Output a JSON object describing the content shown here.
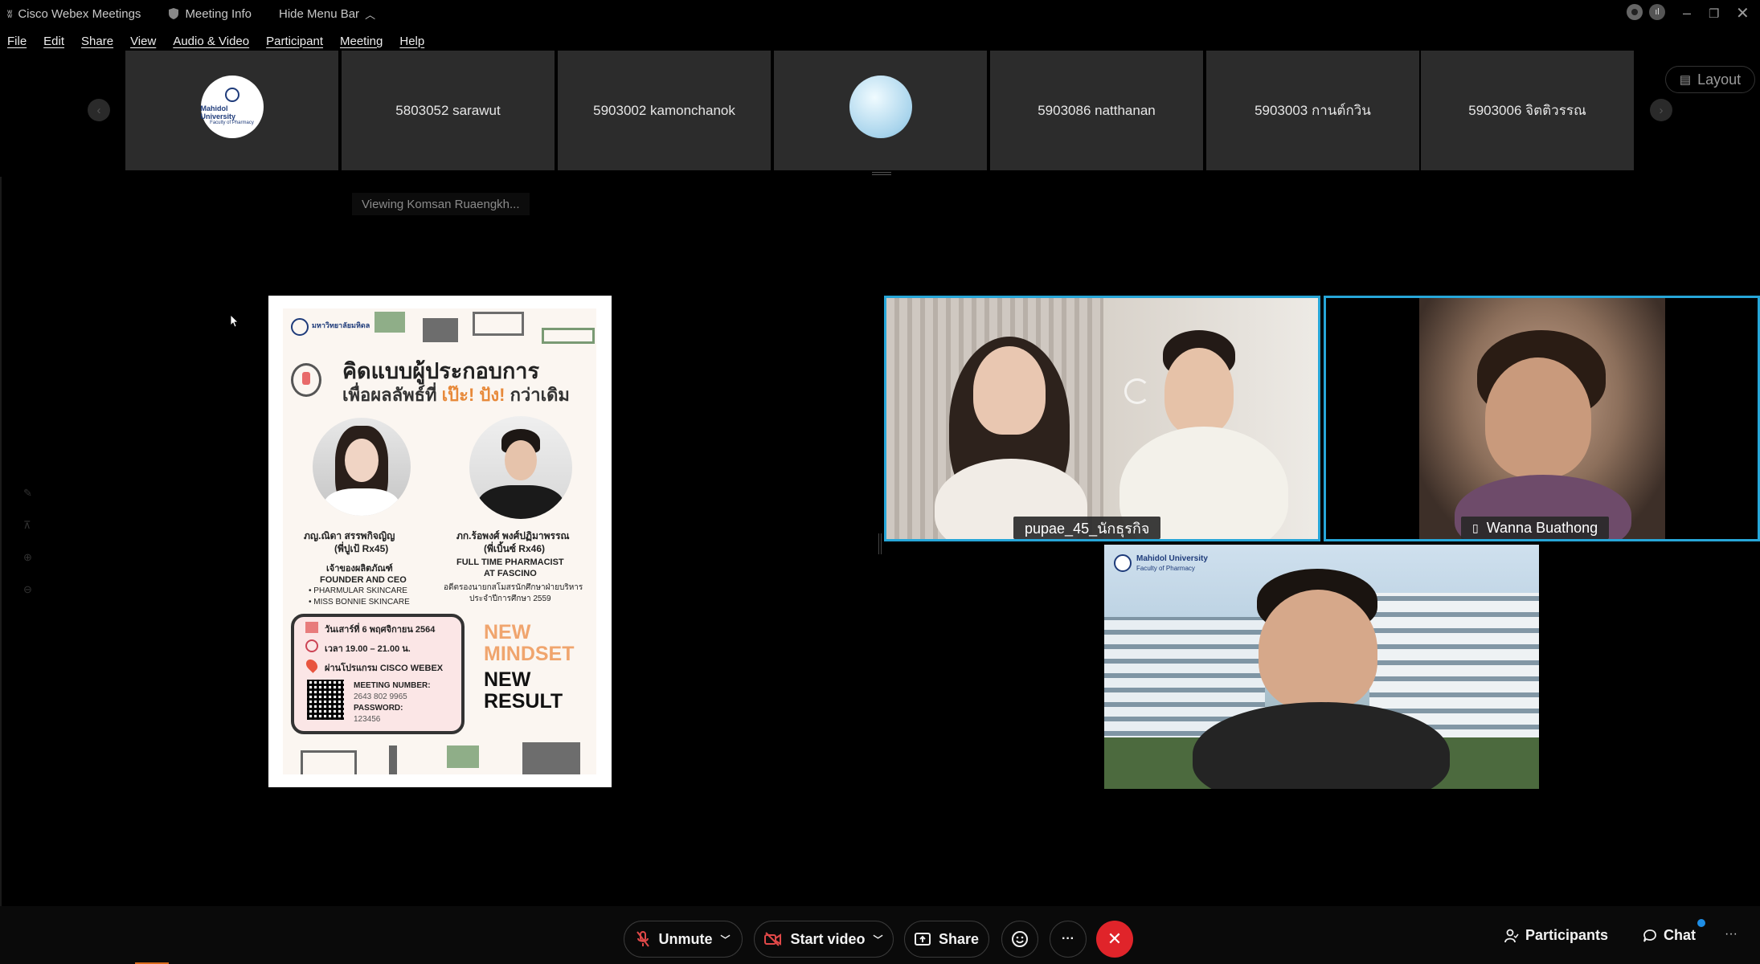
{
  "titlebar": {
    "app_name": "Cisco Webex Meetings",
    "meeting_info": "Meeting Info",
    "hide_menu": "Hide Menu Bar"
  },
  "menu": [
    "File",
    "Edit",
    "Share",
    "View",
    "Audio & Video",
    "Participant",
    "Meeting",
    "Help"
  ],
  "layout_button": "Layout",
  "thumbnails": [
    {
      "type": "logo",
      "logo_line1": "Mahidol University",
      "logo_line2": "Faculty of Pharmacy"
    },
    {
      "type": "name",
      "label": "5803052 sarawut"
    },
    {
      "type": "name",
      "label": "5903002 kamonchanok"
    },
    {
      "type": "avatar"
    },
    {
      "type": "name",
      "label": "5903086 natthanan"
    },
    {
      "type": "name",
      "label": "5903003 กานต์กวิน"
    },
    {
      "type": "name",
      "label": "5903006 จิตติวรรณ"
    }
  ],
  "viewing_text": "Viewing Komsan Ruaengkh...",
  "poster": {
    "uni_name": "มหาวิทยาลัยมหิดล",
    "title_line1": "คิดแบบผู้ประกอบการ",
    "title_line2_a": "เพื่อผลลัพธ์ที่",
    "title_line2_b": "เป๊ะ! ปัง!",
    "title_line2_c": "กว่าเดิม",
    "speaker1_name": "ภญ.ณิดา สรรพกิจญิญ",
    "speaker1_nick": "(พี่ปูเป้ Rx45)",
    "speaker1_role_th": "เจ้าของผลิตภัณฑ์",
    "speaker1_role": "FOUNDER AND CEO",
    "speaker1_brand1": "• PHARMULAR SKINCARE",
    "speaker1_brand2": "• MISS BONNIE SKINCARE",
    "speaker2_name": "ภก.ร้อพงศ์ พงศ์ปฏิมาพรรณ",
    "speaker2_nick": "(พี่เบิ้นซ์ Rx46)",
    "speaker2_role1": "FULL TIME PHARMACIST",
    "speaker2_role2": "AT FASCINO",
    "speaker2_note1": "อดีตรองนายกสโมสรนักศึกษาฝ่ายบริหาร",
    "speaker2_note2": "ประจำปีการศึกษา 2559",
    "date": "วันเสาร์ที่ 6 พฤศจิกายน 2564",
    "time": "เวลา 19.00 – 21.00 น.",
    "platform": "ผ่านโปรแกรม CISCO WEBEX",
    "meeting_label": "MEETING NUMBER:",
    "meeting_number": "2643 802 9965",
    "password_label": "PASSWORD:",
    "password": "123456",
    "slogan1": "NEW",
    "slogan2": "MINDSET",
    "slogan3": "NEW",
    "slogan4": "RESULT"
  },
  "videos": [
    {
      "name": "pupae_45_นักธุรกิจ"
    },
    {
      "name": "Wanna Buathong"
    },
    {
      "name": "",
      "logo_line1": "Mahidol University",
      "logo_line2": "Faculty of Pharmacy"
    }
  ],
  "controls": {
    "unmute": "Unmute",
    "start_video": "Start video",
    "share": "Share",
    "more": "···",
    "participants": "Participants",
    "chat": "Chat",
    "overflow": "···"
  },
  "colors": {
    "active_speaker_border": "#27a6d8",
    "end_button": "#e0242a",
    "tile_bg": "#2c2c2c"
  }
}
